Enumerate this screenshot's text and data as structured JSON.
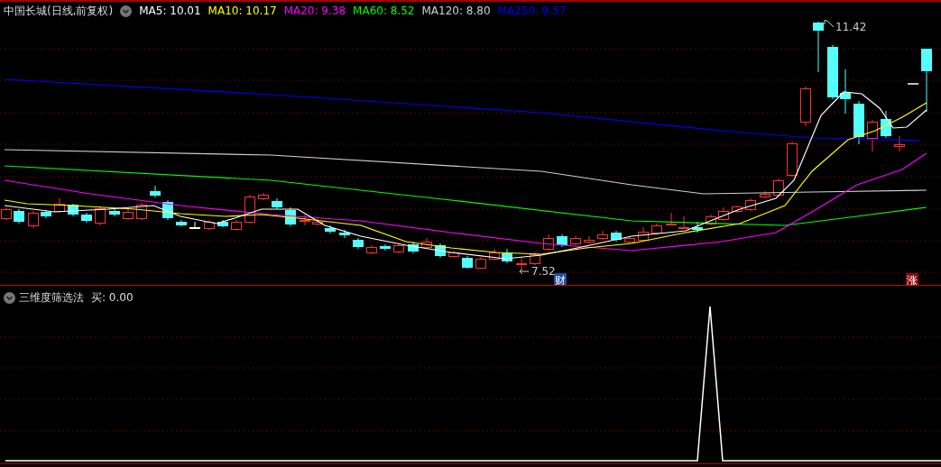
{
  "header": {
    "title": "中国长城(日线,前复权)",
    "moving_averages": [
      {
        "text": "MA5: 10.01",
        "color": "#ffffff"
      },
      {
        "text": "MA10: 10.17",
        "color": "#ffff00"
      },
      {
        "text": "MA20: 9.38",
        "color": "#ff00ff"
      },
      {
        "text": "MA60: 8.52",
        "color": "#00ff00"
      },
      {
        "text": "MA120: 8.80",
        "color": "#d0d0d0"
      },
      {
        "text": "MA250: 9.57",
        "color": "#0000ff"
      }
    ]
  },
  "price_chart": {
    "high_label": "11.42",
    "low_label": "7.52",
    "badges": [
      {
        "text": "财",
        "kind": "finance"
      },
      {
        "text": "涨",
        "kind": "limit"
      }
    ]
  },
  "indicator": {
    "name": "三维度筛选法",
    "reading": "买: 0.00"
  }
}
